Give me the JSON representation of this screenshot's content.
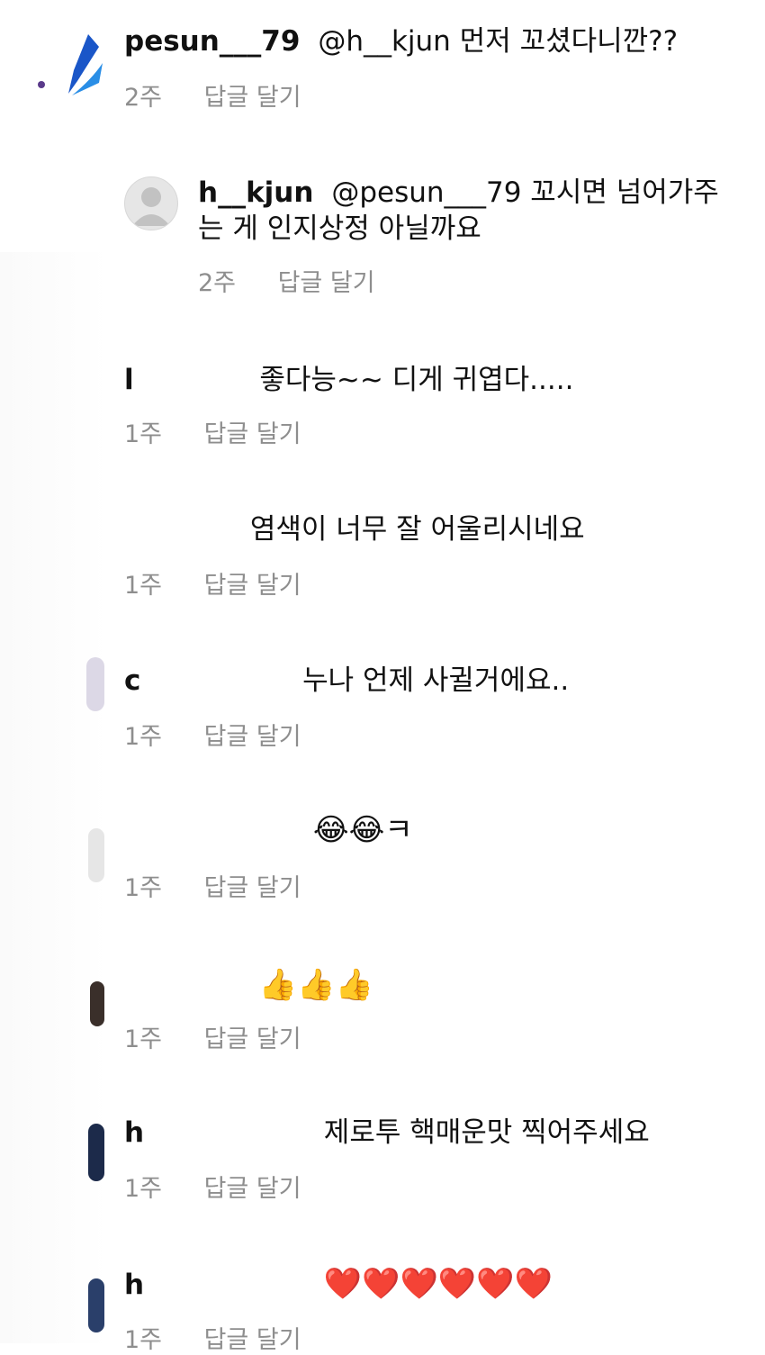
{
  "comments": [
    {
      "username": "pesun___79",
      "text": "@h__kjun 먼저 꼬셨다니깐??",
      "time": "2주",
      "reply_label": "답글 달기",
      "avatar": "logo-avatar-icon",
      "nested": false
    },
    {
      "username": "h__kjun",
      "text": "@pesun___79 꼬시면 넘어가주는 게 인지상정 아닐까요",
      "time": "2주",
      "reply_label": "답글 달기",
      "avatar": "default-profile-icon",
      "nested": true
    },
    {
      "username": "l",
      "text": "좋다능~~ 디게 귀엽다.....",
      "time": "1주",
      "reply_label": "답글 달기",
      "nested": false
    },
    {
      "username": "",
      "text": "염색이 너무 잘 어울리시네요",
      "time": "1주",
      "reply_label": "답글 달기",
      "nested": false
    },
    {
      "username": "c",
      "text": "누나 언제 사귈거에요..",
      "time": "1주",
      "reply_label": "답글 달기",
      "nested": false
    },
    {
      "username": "",
      "text": "😂😂ㅋ",
      "time": "1주",
      "reply_label": "답글 달기",
      "nested": false
    },
    {
      "username": "",
      "text": "👍👍👍",
      "time": "1주",
      "reply_label": "답글 달기",
      "nested": false
    },
    {
      "username": "h",
      "text": "제로투 핵매운맛 찍어주세요",
      "time": "1주",
      "reply_label": "답글 달기",
      "nested": false
    },
    {
      "username": "h",
      "text": "❤️❤️❤️❤️❤️❤️",
      "time": "1주",
      "reply_label": "답글 달기",
      "nested": false
    }
  ],
  "colors": {
    "text": "#111111",
    "meta": "#8e8e8e",
    "link": "#2e5fa8"
  }
}
